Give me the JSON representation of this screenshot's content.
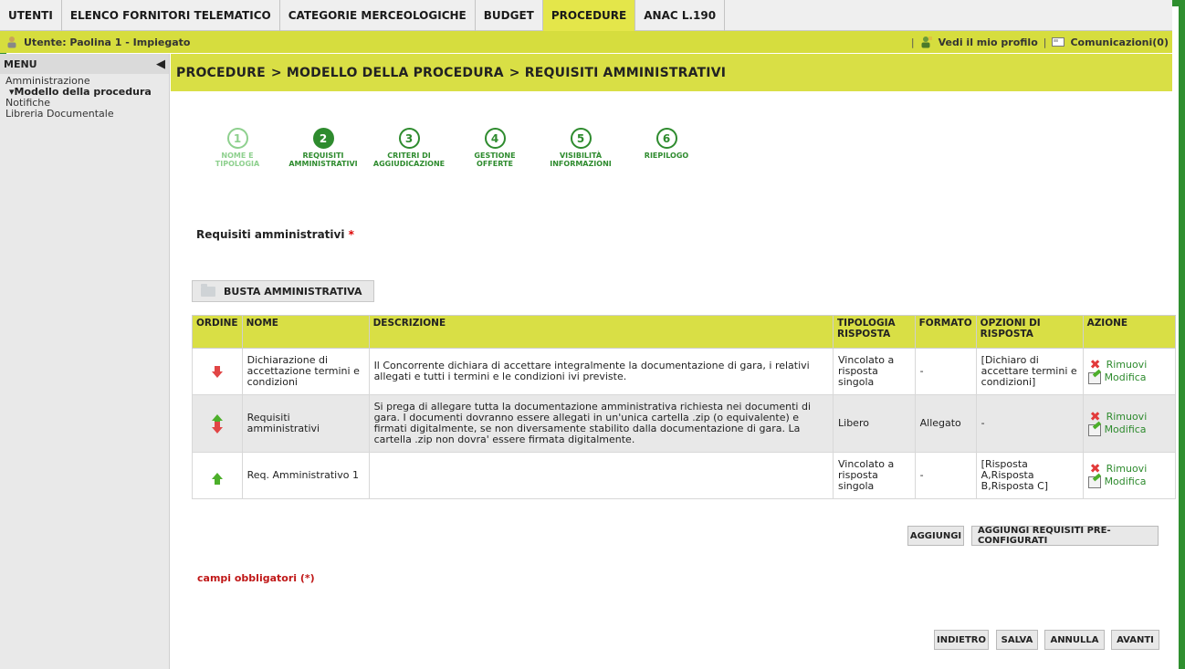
{
  "tabs": [
    "UTENTI",
    "ELENCO FORNITORI TELEMATICO",
    "CATEGORIE MERCEOLOGICHE",
    "BUDGET",
    "PROCEDURE",
    "ANAC L.190"
  ],
  "active_tab": "PROCEDURE",
  "user": {
    "label": "Utente: Paolina 1 - Impiegato",
    "profile_link": "Vedi il mio profilo",
    "comm_link": "Comunicazioni(0)"
  },
  "menu": {
    "title": "MENU",
    "items": [
      "Amministrazione",
      "▾Modello della procedura",
      "Notifiche",
      "Libreria Documentale"
    ]
  },
  "breadcrumb": [
    "PROCEDURE",
    "> MODELLO DELLA PROCEDURA",
    "> REQUISITI AMMINISTRATIVI"
  ],
  "steps": [
    {
      "num": "1",
      "line1": "NOME E",
      "line2": "TIPOLOGIA",
      "state": "done"
    },
    {
      "num": "2",
      "line1": "REQUISITI",
      "line2": "AMMINISTRATIVI",
      "state": "current"
    },
    {
      "num": "3",
      "line1": "CRITERI DI",
      "line2": "AGGIUDICAZIONE",
      "state": "todo"
    },
    {
      "num": "4",
      "line1": "GESTIONE",
      "line2": "OFFERTE",
      "state": "todo"
    },
    {
      "num": "5",
      "line1": "VISIBILITÀ",
      "line2": "INFORMAZIONI",
      "state": "todo"
    },
    {
      "num": "6",
      "line1": "RIEPILOGO",
      "line2": "",
      "state": "todo"
    }
  ],
  "section_title": "Requisiti amministrativi",
  "required_mark": "*",
  "busta_label": "BUSTA AMMINISTRATIVA",
  "table": {
    "headers": [
      "ORDINE",
      "NOME",
      "DESCRIZIONE",
      "TIPOLOGIA RISPOSTA",
      "FORMATO",
      "OPZIONI DI RISPOSTA",
      "AZIONE"
    ],
    "rows": [
      {
        "nome": "Dichiarazione di accettazione termini e condizioni",
        "descrizione": "Il Concorrente dichiara di accettare integralmente la documentazione di gara, i relativi allegati e tutti i termini e le condizioni ivi previste.",
        "tipologia": "Vincolato a risposta singola",
        "formato": "-",
        "opzioni": "[Dichiaro di accettare termini e condizioni]"
      },
      {
        "nome": "Requisiti amministrativi",
        "descrizione": "Si prega di allegare tutta la documentazione amministrativa richiesta nei documenti di gara. I documenti dovranno essere allegati in un'unica cartella .zip (o equivalente) e firmati digitalmente, se non diversamente stabilito dalla documentazione di gara. La cartella .zip non dovra' essere firmata digitalmente.",
        "tipologia": "Libero",
        "formato": "Allegato",
        "opzioni": "-"
      },
      {
        "nome": "Req. Amministrativo 1",
        "descrizione": "",
        "tipologia": "Vincolato a risposta singola",
        "formato": "-",
        "opzioni": "[Risposta A,Risposta B,Risposta C]"
      }
    ],
    "action_remove": "Rimuovi",
    "action_edit": "Modifica"
  },
  "buttons": {
    "aggiungi": "AGGIUNGI",
    "aggiungi_pre": "AGGIUNGI REQUISITI PRE-CONFIGURATI",
    "indietro": "INDIETRO",
    "salva": "SALVA",
    "annulla": "ANNULLA",
    "avanti": "AVANTI"
  },
  "required_note": "campi obbligatori (*)",
  "colors": {
    "frame": "#2f8f2f",
    "accent": "#d9df45",
    "active_tab": "#e4e64a",
    "step_green": "#2e8b2e"
  }
}
